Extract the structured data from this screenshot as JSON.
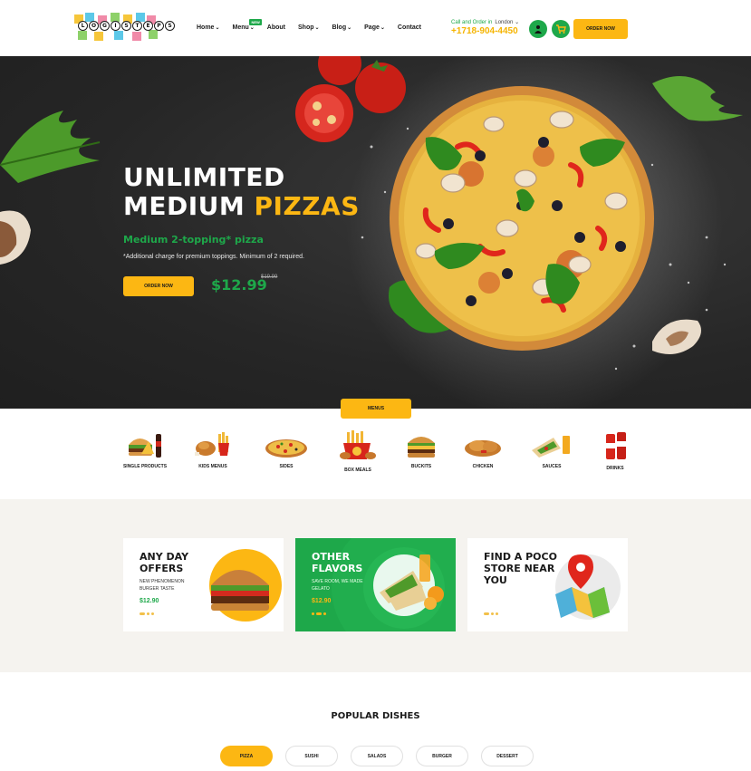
{
  "brand": {
    "logo_letters": [
      "L",
      "O",
      "G",
      "I",
      "S",
      "T",
      "E",
      "P",
      "S"
    ]
  },
  "nav": {
    "items": [
      {
        "label": "Home",
        "has_dropdown": true
      },
      {
        "label": "Menu",
        "has_dropdown": true,
        "badge": "NEW"
      },
      {
        "label": "About",
        "has_dropdown": false
      },
      {
        "label": "Shop",
        "has_dropdown": true
      },
      {
        "label": "Blog",
        "has_dropdown": true
      },
      {
        "label": "Page",
        "has_dropdown": true
      },
      {
        "label": "Contact",
        "has_dropdown": false
      }
    ],
    "chevron": "⌄"
  },
  "header": {
    "call_label": "Call and Order in",
    "city": "London",
    "phone": "+1718-904-4450",
    "order_label": "ORDER NOW",
    "icons": [
      "user-icon",
      "cart-icon"
    ]
  },
  "hero": {
    "title_line1": "UNLIMITED",
    "title_line2_plain": "MEDIUM ",
    "title_line2_accent": "PIZZAS",
    "subtitle": "Medium 2-topping* pizza",
    "note": "*Additional charge for premium toppings. Minimum of 2 required.",
    "order_label": "ORDER NOW",
    "price": "$12.99",
    "old_price": "$19.99"
  },
  "menus": {
    "tag": "MENUS",
    "categories": [
      {
        "label": "SINGLE PRODUCTS",
        "icon": "burger-combo-icon"
      },
      {
        "label": "KIDS MENUS",
        "icon": "fried-chicken-icon"
      },
      {
        "label": "SIDES",
        "icon": "pizza-icon"
      },
      {
        "label": "BOX MEALS",
        "icon": "fries-box-icon"
      },
      {
        "label": "BUCKITS",
        "icon": "burger-icon"
      },
      {
        "label": "CHICKEN",
        "icon": "chicken-icon"
      },
      {
        "label": "SAUCES",
        "icon": "wrap-icon"
      },
      {
        "label": "DRINKS",
        "icon": "drink-can-icon"
      }
    ]
  },
  "offers": [
    {
      "title": "ANY DAY OFFERS",
      "desc": "NEW PHENOMENON BURGER TASTE",
      "price": "$12.90"
    },
    {
      "title": "OTHER FLAVORS",
      "desc": "SAVE ROOM, WE MADE GELATO",
      "price": "$12.90"
    },
    {
      "title": "FIND A POCO STORE NEAR YOU",
      "desc": "",
      "price": ""
    }
  ],
  "popular": {
    "title": "POPULAR DISHES",
    "tabs": [
      "PIZZA",
      "SUSHI",
      "SALADS",
      "BURGER",
      "DESSERT"
    ],
    "active": "PIZZA"
  },
  "colors": {
    "accent": "#fcb713",
    "green": "#1ea84a",
    "dark": "#262626",
    "cream": "#f5f3ef"
  }
}
